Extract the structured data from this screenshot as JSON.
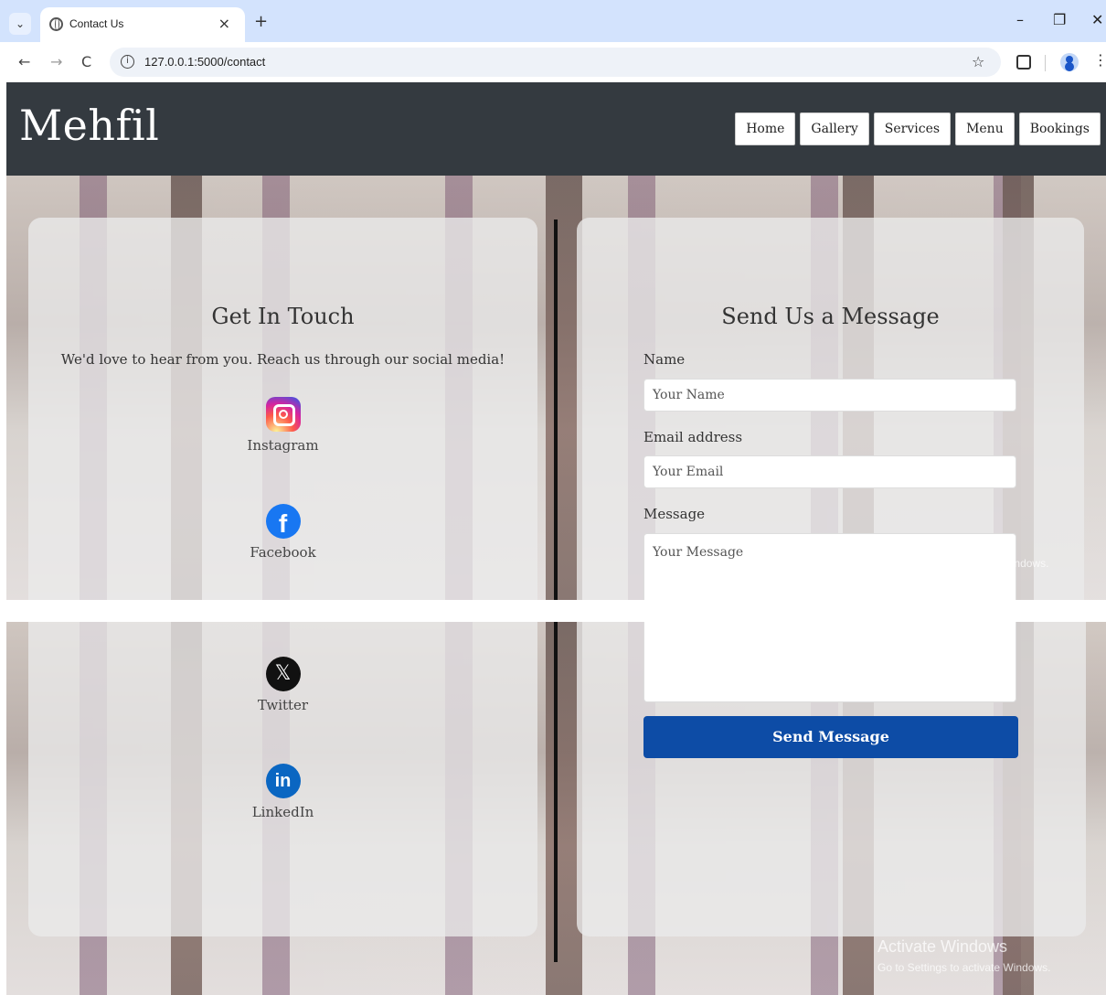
{
  "browser": {
    "tab_title": "Contact Us",
    "tab_close": "×",
    "new_tab": "+",
    "url": "127.0.0.1:5000/contact",
    "window_minimize": "–",
    "window_restore": "❐",
    "window_close": "✕",
    "back": "←",
    "forward": "→",
    "reload": "C",
    "menu": "⋮",
    "bookmark": "☆",
    "tab_list": "⌄"
  },
  "site": {
    "brand": "Mehfil",
    "nav": [
      "Home",
      "Gallery",
      "Services",
      "Menu",
      "Bookings"
    ]
  },
  "contact": {
    "heading": "Get In Touch",
    "lead": "We'd love to hear from you. Reach us through our social media!",
    "socials": [
      {
        "label": "Instagram",
        "icon": "instagram-icon"
      },
      {
        "label": "Facebook",
        "icon": "facebook-icon"
      },
      {
        "label": "Twitter",
        "icon": "x-twitter-icon"
      },
      {
        "label": "LinkedIn",
        "icon": "linkedin-icon"
      }
    ]
  },
  "form": {
    "heading": "Send Us a Message",
    "name_label": "Name",
    "name_placeholder": "Your Name",
    "email_label": "Email address",
    "email_placeholder": "Your Email",
    "message_label": "Message",
    "message_placeholder": "Your Message",
    "submit": "Send Message"
  },
  "watermark": {
    "title": "Activate Windows",
    "subtitle": "Go to Settings to activate Windows."
  },
  "colors": {
    "header_bg": "#343a40",
    "button_primary": "#0d4ca6",
    "tabbar": "#d3e3fd"
  }
}
